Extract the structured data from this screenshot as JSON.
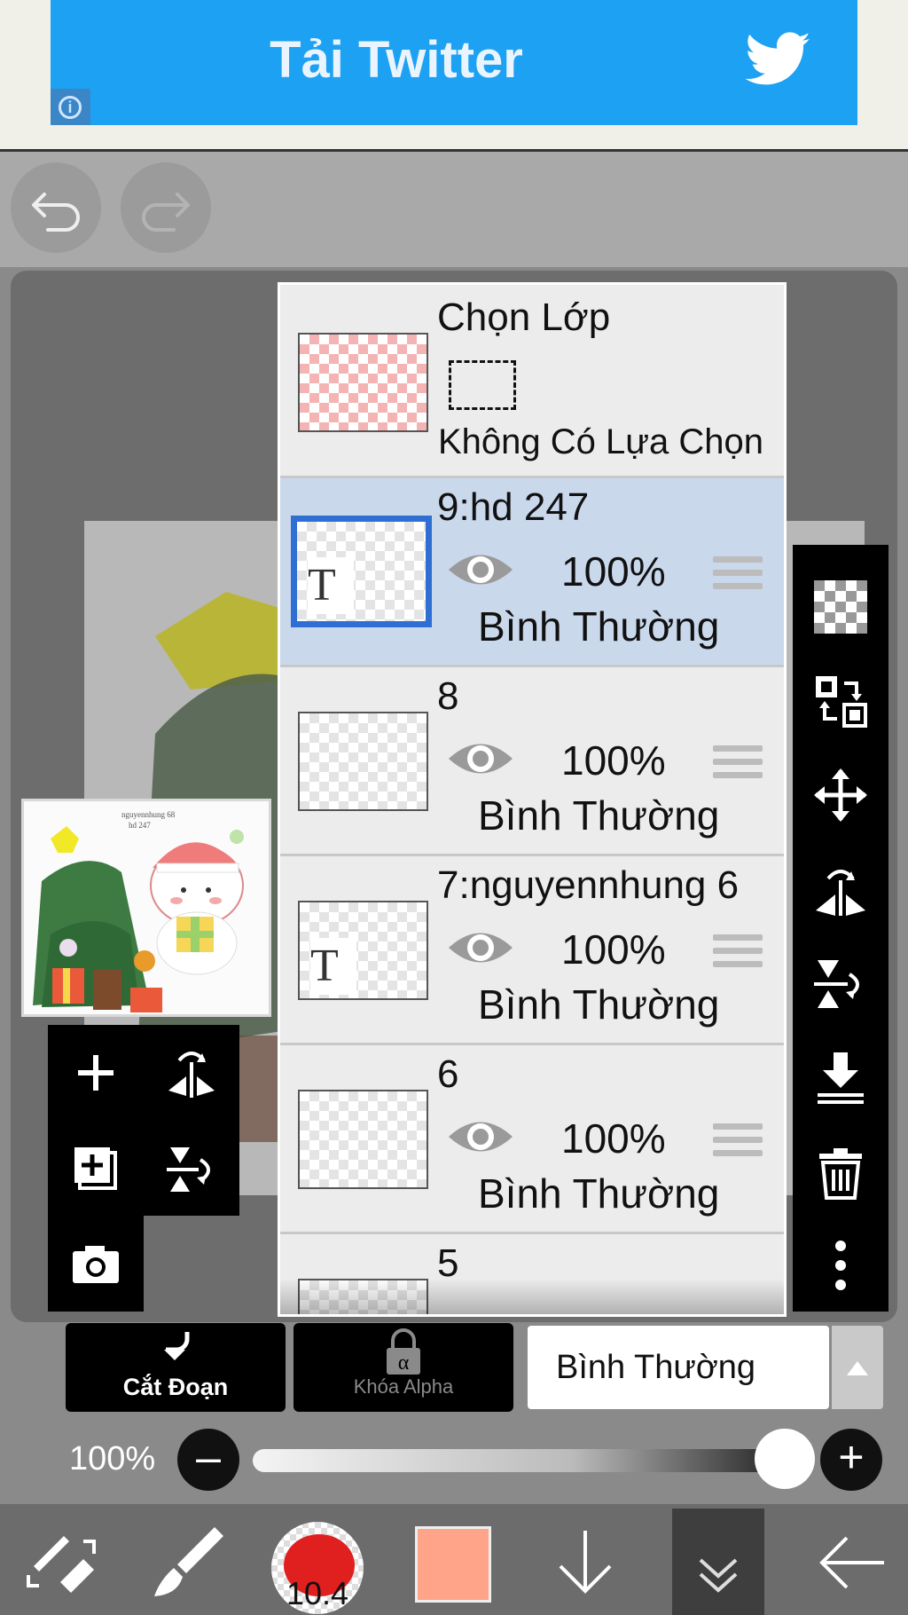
{
  "ad": {
    "title": "Tải Twitter",
    "info_icon": "info-icon",
    "brand_icon": "twitter-bird-icon",
    "color": "#1da1f2"
  },
  "toolbar": {
    "undo_icon": "undo-icon",
    "redo_icon": "redo-icon"
  },
  "thumbnail": {
    "caption_line1": "nguyennhung 68",
    "caption_line2": "hd 247"
  },
  "layers": {
    "selection_row": {
      "title": "Chọn Lớp",
      "subtitle": "Không Có Lựa Chọn"
    },
    "items": [
      {
        "name": "9:hd 247",
        "opacity": "100%",
        "blend": "Bình Thường",
        "type": "text",
        "selected": true
      },
      {
        "name": "8",
        "opacity": "100%",
        "blend": "Bình Thường",
        "type": "raster",
        "selected": false
      },
      {
        "name": "7:nguyennhung 6",
        "opacity": "100%",
        "blend": "Bình Thường",
        "type": "text",
        "selected": false
      },
      {
        "name": "6",
        "opacity": "100%",
        "blend": "Bình Thường",
        "type": "raster",
        "selected": false
      },
      {
        "name": "5",
        "opacity": "",
        "blend": "",
        "type": "raster",
        "selected": false
      }
    ]
  },
  "left_tools": [
    "add-layer-icon",
    "flip-horizontal-icon",
    "duplicate-layer-icon",
    "flip-vertical-icon",
    "camera-icon"
  ],
  "right_tools": [
    "transparency-icon",
    "swap-layer-icon",
    "move-icon",
    "flip-h-icon",
    "flip-v-icon",
    "merge-down-icon",
    "trash-icon",
    "more-icon"
  ],
  "bottom_controls": {
    "clip_label": "Cắt Đoạn",
    "alpha_lock_label": "Khóa Alpha",
    "blend_mode": "Bình Thường",
    "opacity_label": "100%",
    "opacity_value": 1.0
  },
  "bottom_bar": {
    "brush_size": "10.4",
    "current_color": "#ffa488",
    "icons": [
      "tool-swap-icon",
      "brush-icon",
      "brush-size-icon",
      "color-swatch",
      "arrow-down-icon",
      "double-chevron-down-icon",
      "back-arrow-icon"
    ]
  }
}
